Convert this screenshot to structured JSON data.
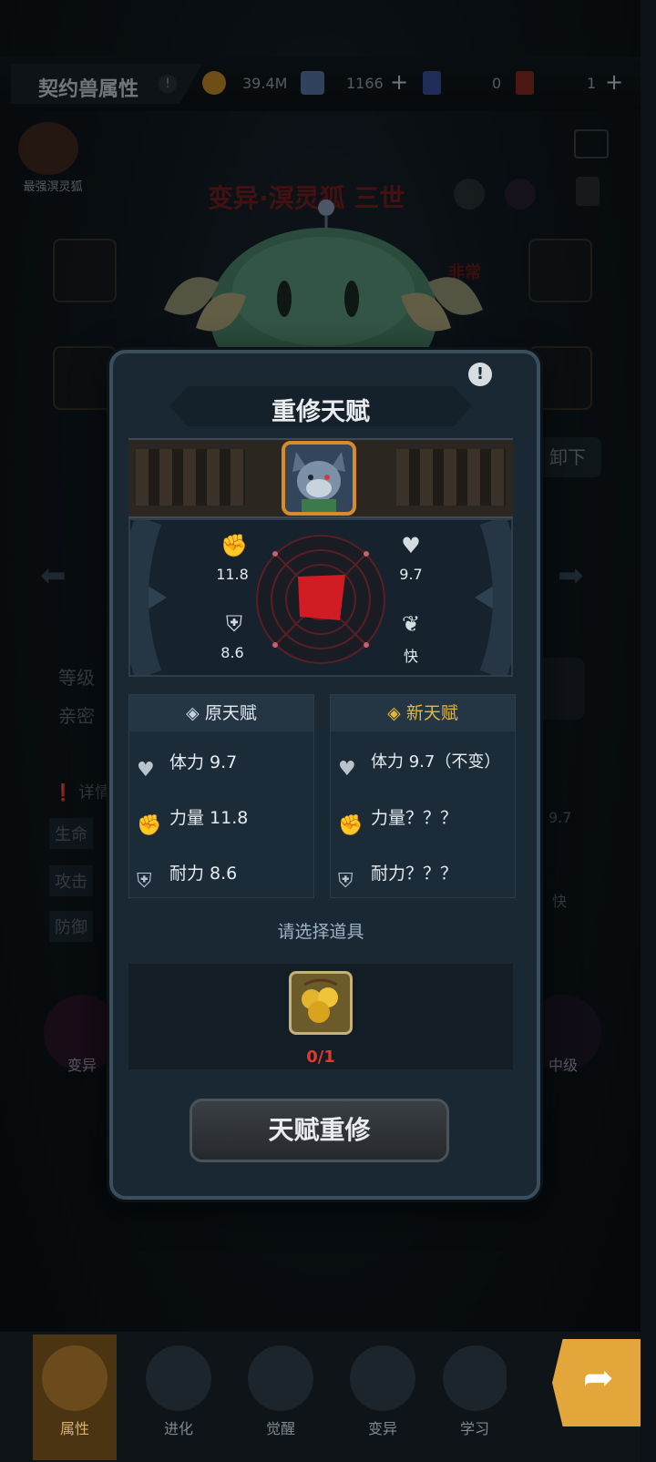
{
  "header": {
    "title": "契约兽属性",
    "resources": [
      {
        "icon": "gold-coin-icon",
        "value": "39.4M"
      },
      {
        "icon": "crystal-icon",
        "value": "1166"
      },
      {
        "icon": "blue-card-icon",
        "value": "0"
      },
      {
        "icon": "red-card-icon",
        "value": "1"
      }
    ]
  },
  "pet": {
    "rank_label": "最强溟灵狐",
    "name": "变异·溟灵狐 三世",
    "rarity": "非常稀"
  },
  "background": {
    "unequip": "卸下",
    "level_label": "等级",
    "intimacy_label": "亲密",
    "detail_label": "详情",
    "life_label": "生命",
    "attack_label": "攻击",
    "defense_label": "防御",
    "side_value": "9.7",
    "side_speed": "快",
    "mutate_badge": "变异",
    "mid_badge": "中级"
  },
  "modal": {
    "title": "重修天赋",
    "radar": {
      "strength": "11.8",
      "stamina": "9.7",
      "endurance": "8.6",
      "speed": "快"
    },
    "original": {
      "header": "原天赋",
      "rows": [
        {
          "icon": "heart-icon",
          "text": "体力 9.7"
        },
        {
          "icon": "fist-icon",
          "text": "力量 11.8"
        },
        {
          "icon": "armor-icon",
          "text": "耐力 8.6"
        }
      ]
    },
    "new": {
      "header": "新天赋",
      "rows": [
        {
          "icon": "heart-icon",
          "text": "体力 9.7（不变）"
        },
        {
          "icon": "fist-icon",
          "text": "力量？？？"
        },
        {
          "icon": "armor-icon",
          "text": "耐力？？？"
        }
      ]
    },
    "select_prompt": "请选择道具",
    "item_count": "0/1",
    "action": "天赋重修"
  },
  "nav": [
    "属性",
    "进化",
    "觉醒",
    "变异",
    "学习"
  ],
  "colors": {
    "accent_gold": "#e7b63a",
    "count_red": "#e03a2e",
    "frame_orange": "#d98a2b"
  }
}
